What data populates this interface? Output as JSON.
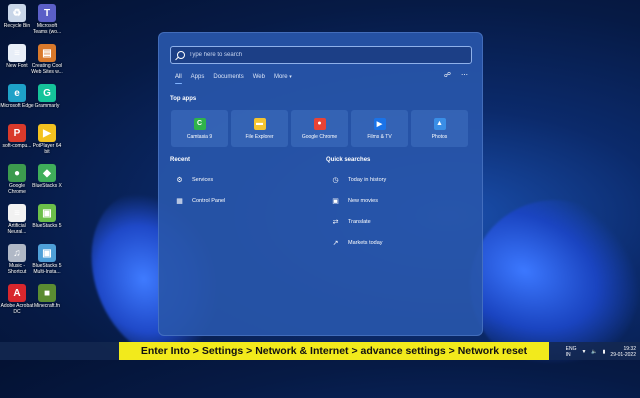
{
  "desktop": {
    "icons": [
      {
        "label": "Recycle Bin",
        "icon": "recycle-bin-icon",
        "color": "#c9d6e8",
        "glyph": "♻"
      },
      {
        "label": "Microsoft Teams (wo...",
        "icon": "teams-icon",
        "color": "#5b5fc7",
        "glyph": "T"
      },
      {
        "label": "New Font",
        "icon": "document-icon",
        "color": "#e8eef7",
        "glyph": "≡"
      },
      {
        "label": "Creating Cool Web Sites w...",
        "icon": "book-icon",
        "color": "#d9792b",
        "glyph": "▤"
      },
      {
        "label": "Microsoft Edge",
        "icon": "edge-icon",
        "color": "#1ea2c8",
        "glyph": "e"
      },
      {
        "label": "Grammarly",
        "icon": "grammarly-icon",
        "color": "#15c39a",
        "glyph": "G"
      },
      {
        "label": "soft-compu...",
        "icon": "pdf-icon",
        "color": "#d93a2b",
        "glyph": "P"
      },
      {
        "label": "PotPlayer 64 bit",
        "icon": "potplayer-icon",
        "color": "#f3c220",
        "glyph": "▶"
      },
      {
        "label": "Google Chrome",
        "icon": "chrome-icon",
        "color": "#3c9b4e",
        "glyph": "●"
      },
      {
        "label": "BlueStacks X",
        "icon": "bluestacks-x-icon",
        "color": "#3fae5a",
        "glyph": "◆"
      },
      {
        "label": "Artificial Neural...",
        "icon": "document-icon",
        "color": "#f1f1f1",
        "glyph": "≡"
      },
      {
        "label": "BlueStacks 5",
        "icon": "bluestacks-icon",
        "color": "#6cc04a",
        "glyph": "▣"
      },
      {
        "label": "Music - Shortcut",
        "icon": "music-icon",
        "color": "#b0b8c6",
        "glyph": "♫"
      },
      {
        "label": "BlueStacks 5 Multi-Insta...",
        "icon": "bluestacks-multi-icon",
        "color": "#4fa0d8",
        "glyph": "▣"
      },
      {
        "label": "Adobe Acrobat DC",
        "icon": "acrobat-icon",
        "color": "#d8272d",
        "glyph": "A"
      },
      {
        "label": "Minecraft.fn",
        "icon": "minecraft-icon",
        "color": "#5b8c32",
        "glyph": "■"
      }
    ]
  },
  "start_menu": {
    "search_placeholder": "Type here to search",
    "tabs": [
      {
        "label": "All",
        "active": true
      },
      {
        "label": "Apps"
      },
      {
        "label": "Documents"
      },
      {
        "label": "Web"
      },
      {
        "label": "More"
      }
    ],
    "top_apps_title": "Top apps",
    "top_apps": [
      {
        "label": "Camtasia 9",
        "icon": "camtasia-icon",
        "color": "#2fb34a",
        "glyph": "C"
      },
      {
        "label": "File Explorer",
        "icon": "folder-icon",
        "color": "#f4c430",
        "glyph": "▬"
      },
      {
        "label": "Google Chrome",
        "icon": "chrome-icon",
        "color": "#e84335",
        "glyph": "●"
      },
      {
        "label": "Films & TV",
        "icon": "films-tv-icon",
        "color": "#1a73e8",
        "glyph": "▶"
      },
      {
        "label": "Photos",
        "icon": "photos-icon",
        "color": "#3a8ee6",
        "glyph": "▲"
      }
    ],
    "recent_title": "Recent",
    "recent": [
      {
        "label": "Services",
        "icon": "gears-icon",
        "glyph": "⚙"
      },
      {
        "label": "Control Panel",
        "icon": "control-panel-icon",
        "glyph": "▦"
      }
    ],
    "quick_title": "Quick searches",
    "quick": [
      {
        "label": "Today in history",
        "icon": "clock-icon",
        "glyph": "◷"
      },
      {
        "label": "New movies",
        "icon": "film-icon",
        "glyph": "▣"
      },
      {
        "label": "Translate",
        "icon": "translate-icon",
        "glyph": "⇄"
      },
      {
        "label": "Markets today",
        "icon": "chart-icon",
        "glyph": "↗"
      }
    ]
  },
  "taskbar": {
    "lang_top": "ENG",
    "lang_bottom": "IN",
    "time": "19:32",
    "date": "29-01-2022"
  },
  "caption": "Enter Into > Settings > Network & Internet > advance settings > Network reset"
}
